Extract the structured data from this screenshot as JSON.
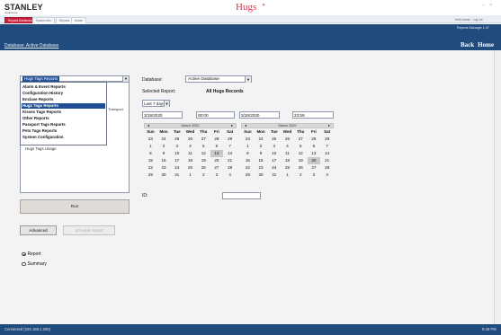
{
  "app": {
    "logo": "STANLEY",
    "logo_sub": "Healthcare",
    "product": "Hugs",
    "window_controls": "– ×",
    "user": "Hello Admin · Log out"
  },
  "tabs": [
    {
      "label": "Reports Dashboard",
      "active": true
    },
    {
      "label": "System Info",
      "active": false
    },
    {
      "label": "Reports",
      "active": false
    },
    {
      "label": "Admin",
      "active": false
    }
  ],
  "banner": {
    "subtitle": "Reports Manager 1.47",
    "breadcrumb": "Database: Active Database",
    "back": "Back",
    "home": "Home"
  },
  "left": {
    "report_category": "Hugs Tags Reports",
    "dropdown_items": [
      {
        "label": "Alarm & Event Reports",
        "selected": false
      },
      {
        "label": "Configuration History",
        "selected": false
      },
      {
        "label": "Enclave Reports",
        "selected": false
      },
      {
        "label": "Hugs Tags Reports",
        "selected": true
      },
      {
        "label": "Kisses Tags Reports",
        "selected": false
      },
      {
        "label": "Other Reports",
        "selected": false
      },
      {
        "label": "Passport Tags Reports",
        "selected": false
      },
      {
        "label": "Pets Tags Reports",
        "selected": false
      },
      {
        "label": "System Configuration",
        "selected": false
      }
    ],
    "list_tail_1": "Transport",
    "list_tail_2": "Hugs Tags Usage",
    "run_label": "Run",
    "advanced_label": "Advanced",
    "schedule_label": "Schedule Report",
    "radio_report": "Report",
    "radio_summary": "Summary"
  },
  "right": {
    "database_label": "Database:",
    "database_value": "Active Database",
    "selected_report_label": "Selected Report:",
    "selected_report_value": "All Hugs Records",
    "period_value": "Last 7 days",
    "start_date": "3/19/2020",
    "start_time": "00:00",
    "end_date": "3/26/2020",
    "end_time": "23:59",
    "id_label": "ID:",
    "calendars": [
      {
        "nav_prev": "◄",
        "month": "March 2020",
        "nav_next": "►",
        "dows": [
          "Sun",
          "Mon",
          "Tue",
          "Wed",
          "Thu",
          "Fri",
          "Sat"
        ],
        "days": [
          "23",
          "24",
          "25",
          "26",
          "27",
          "28",
          "29",
          "1",
          "2",
          "3",
          "4",
          "5",
          "6",
          "7",
          "8",
          "9",
          "10",
          "11",
          "12",
          "13",
          "14",
          "15",
          "16",
          "17",
          "18",
          "19",
          "20",
          "21",
          "22",
          "23",
          "24",
          "25",
          "26",
          "27",
          "28",
          "29",
          "30",
          "31",
          "1",
          "2",
          "3",
          "4"
        ],
        "highlight": 19
      },
      {
        "nav_prev": "◄",
        "month": "March 2020",
        "nav_next": "►",
        "dows": [
          "Sun",
          "Mon",
          "Tue",
          "Wed",
          "Thu",
          "Fri",
          "Sat"
        ],
        "days": [
          "23",
          "24",
          "25",
          "26",
          "27",
          "28",
          "29",
          "1",
          "2",
          "3",
          "4",
          "5",
          "6",
          "7",
          "8",
          "9",
          "10",
          "11",
          "12",
          "13",
          "14",
          "15",
          "16",
          "17",
          "18",
          "19",
          "20",
          "21",
          "22",
          "23",
          "24",
          "25",
          "26",
          "27",
          "28",
          "29",
          "30",
          "31",
          "1",
          "2",
          "3",
          "4"
        ],
        "highlight": 26
      }
    ]
  },
  "status": {
    "left": "Connected (192.168.1.250)",
    "right": "8:48 PM"
  }
}
